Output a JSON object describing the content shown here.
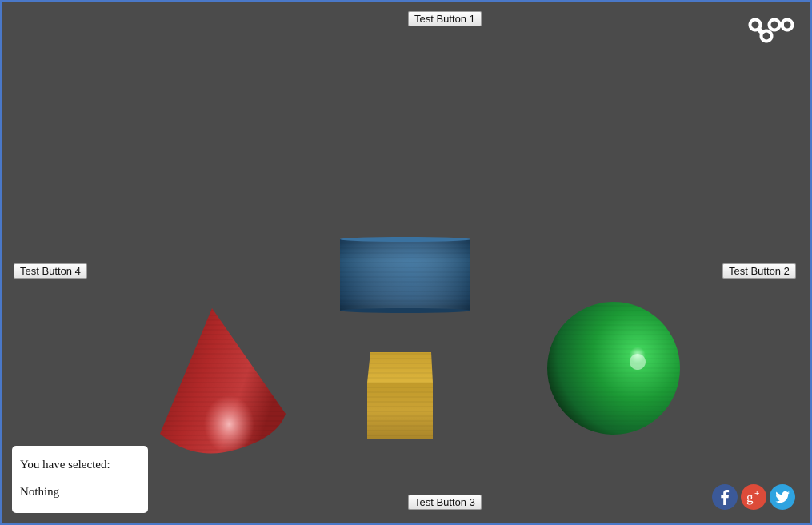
{
  "buttons": {
    "test1": "Test Button 1",
    "test2": "Test Button 2",
    "test3": "Test Button 3",
    "test4": "Test Button 4"
  },
  "selection_panel": {
    "prompt": "You have selected:",
    "value": "Nothing"
  },
  "logo": {
    "icon": "goo-logo-icon"
  },
  "social": [
    {
      "icon": "facebook-icon",
      "color": "#3b5998"
    },
    {
      "icon": "google-plus-icon",
      "color": "#dd4b39"
    },
    {
      "icon": "twitter-icon",
      "color": "#2ea3e0"
    }
  ],
  "scene": {
    "background": "#4b4b4b",
    "objects": [
      {
        "shape": "cylinder",
        "color": "#2c5f88"
      },
      {
        "shape": "cone",
        "color": "#a52323"
      },
      {
        "shape": "cube",
        "color": "#c9a12e"
      },
      {
        "shape": "sphere",
        "color": "#1f9a3a"
      }
    ]
  }
}
